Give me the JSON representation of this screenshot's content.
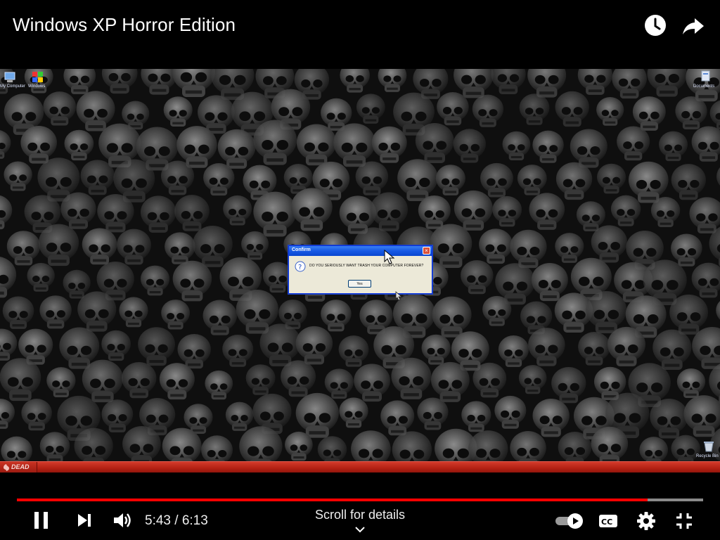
{
  "header": {
    "title": "Windows XP Horror Edition",
    "icons": [
      "watch-later-icon",
      "share-icon"
    ]
  },
  "desktop": {
    "icons": [
      {
        "label": "My Computer"
      },
      {
        "label": "Windows"
      },
      {
        "label": "Documents"
      },
      {
        "label": "Recycle Bin"
      }
    ],
    "taskbar": {
      "start_label": "DEAD",
      "color": "#c12a1a"
    }
  },
  "dialog": {
    "title": "Confirm",
    "message": "DO YOU SERIOUSLY WANT TRASH YOUR COMPUTER FOREVER?",
    "button": "Yes",
    "close": "×"
  },
  "player": {
    "current_time": "5:43",
    "duration": "6:13",
    "time_display": "5:43 / 6:13",
    "progress_fraction": 0.919,
    "scroll_hint": "Scroll for details",
    "accent_color": "#ff0000",
    "controls": [
      "pause-icon",
      "next-icon",
      "volume-icon",
      "autoplay-toggle",
      "captions-icon",
      "settings-icon",
      "exit-fullscreen-icon"
    ]
  }
}
